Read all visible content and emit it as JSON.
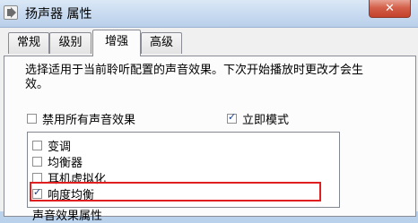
{
  "window": {
    "title": "扬声器 属性",
    "close_label": "✕"
  },
  "tabs": [
    {
      "label": "常规"
    },
    {
      "label": "级别"
    },
    {
      "label": "增强"
    },
    {
      "label": "高级"
    }
  ],
  "enhancements": {
    "description": "选择适用于当前聆听配置的声音效果。下次开始播放时更改才会生效。",
    "disable_all": {
      "label": "禁用所有声音效果",
      "checked": false
    },
    "immediate_mode": {
      "label": "立即模式",
      "checked": true
    },
    "items": [
      {
        "label": "变调",
        "checked": false
      },
      {
        "label": "均衡器",
        "checked": false
      },
      {
        "label": "耳机虚拟化",
        "checked": false
      },
      {
        "label": "响度均衡",
        "checked": true
      }
    ],
    "bottom_label": "声音效果属性"
  },
  "colors": {
    "highlight": "#e02020",
    "titlebar": "#c7daf0",
    "close_button": "#c4412a"
  },
  "icons": {
    "app": "speaker-icon",
    "check": "✓"
  }
}
